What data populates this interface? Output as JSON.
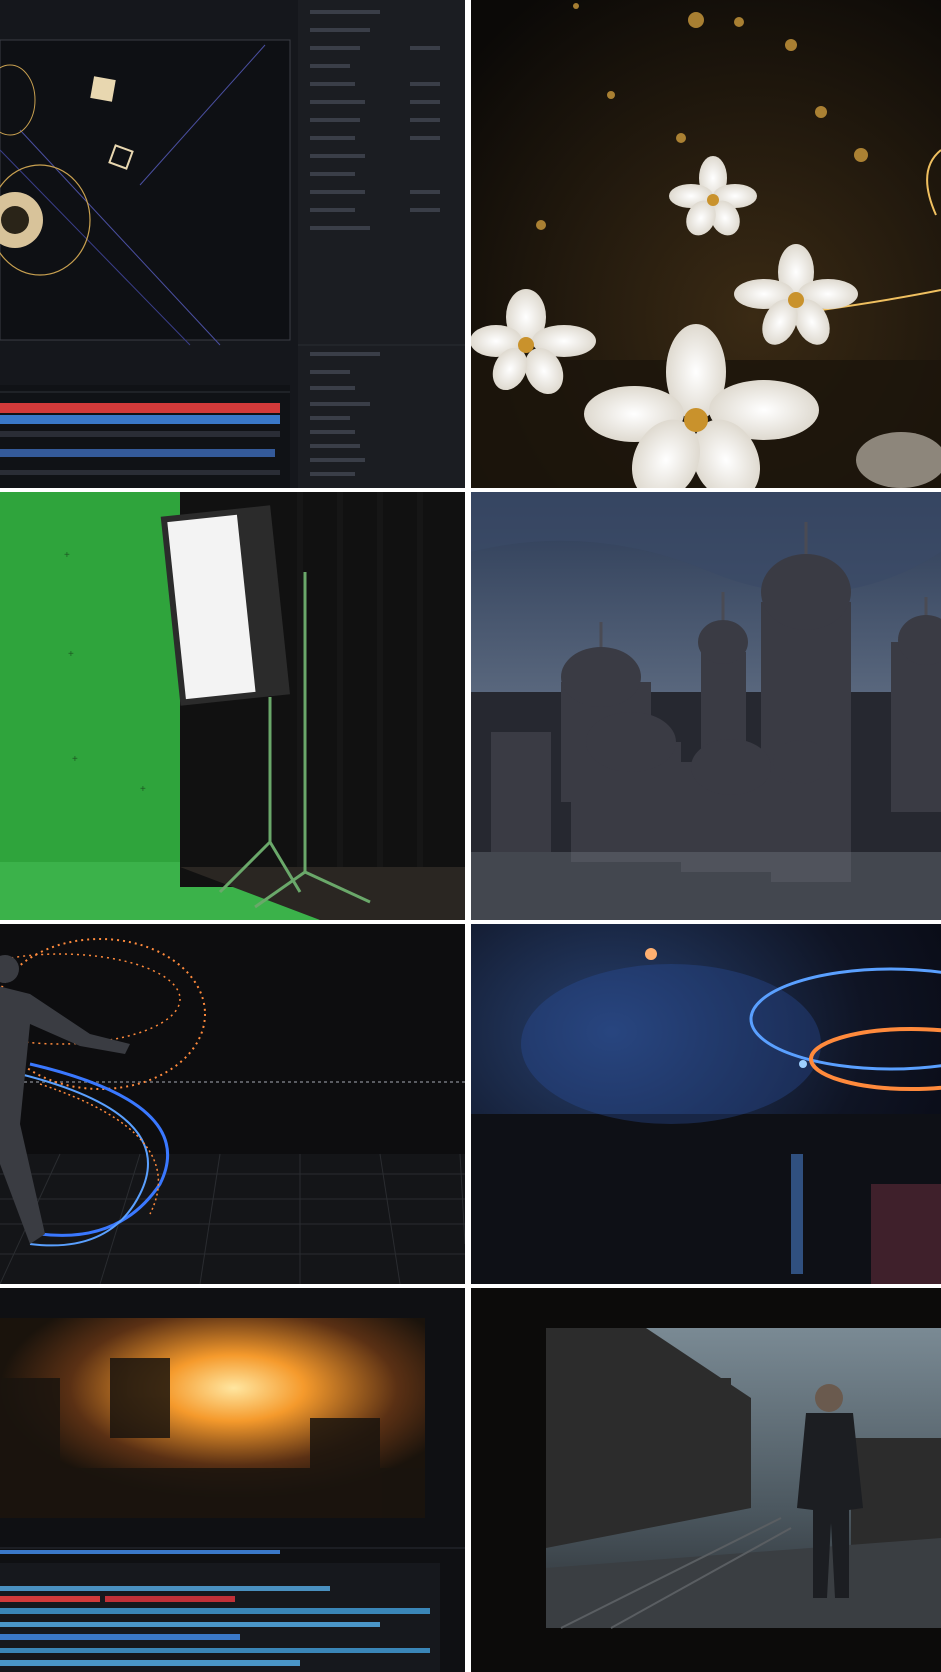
{
  "collage": {
    "tiles": [
      {
        "subject": "compositing-software-interface"
      },
      {
        "subject": "glowing-white-flowers"
      },
      {
        "subject": "green-screen-studio"
      },
      {
        "subject": "fantasy-domed-city"
      },
      {
        "subject": "motion-capture-particles"
      },
      {
        "subject": "energy-rings-night"
      },
      {
        "subject": "explosion-edit-timeline"
      },
      {
        "subject": "man-in-ruined-city-on-monitor"
      }
    ]
  },
  "colors": {
    "ui_bg": "#15171c",
    "green_screen": "#2fa43c",
    "track_red": "#d23a3a",
    "track_blue": "#3a78c8",
    "gold": "#e6b866",
    "ring_orange": "#ff8a3c",
    "ring_blue": "#5aa0ff"
  }
}
